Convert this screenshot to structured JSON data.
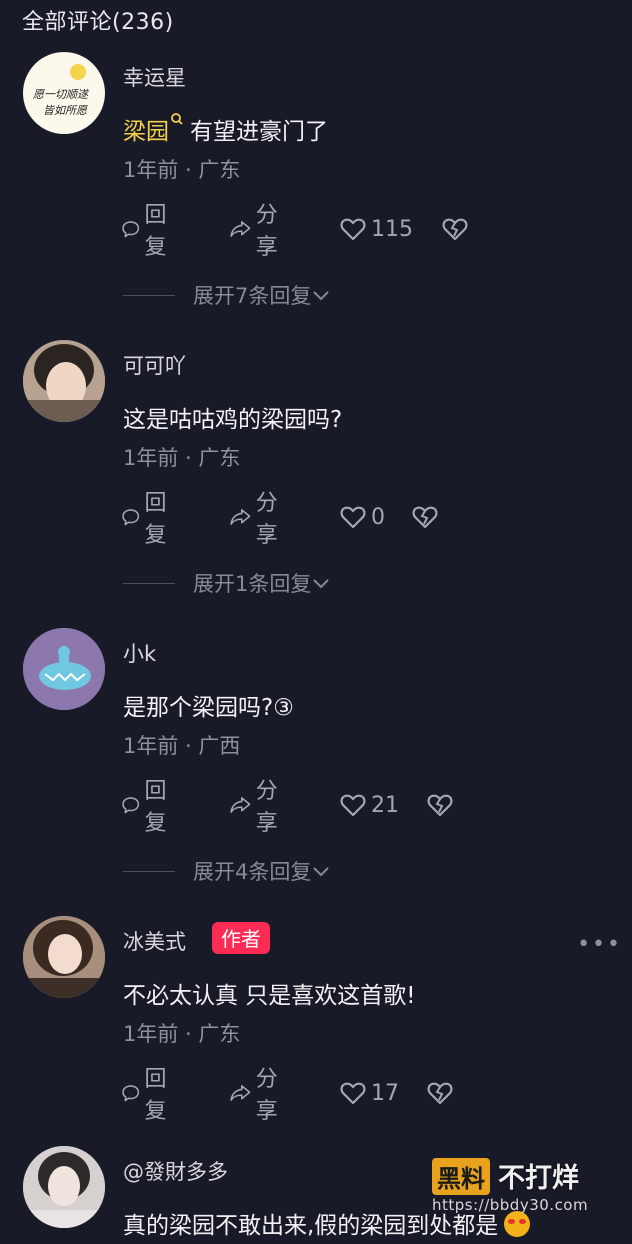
{
  "header": {
    "title": "全部评论(236)"
  },
  "comments": [
    {
      "username": "幸运星",
      "content_keyword": "梁园",
      "content_rest": "有望进豪门了",
      "meta": "1年前 · 广东",
      "reply_label": "回复",
      "share_label": "分享",
      "likes": "115",
      "expand": "展开7条回复",
      "avatar_text_1": "愿一切顺遂",
      "avatar_text_2": "皆如所愿"
    },
    {
      "username": "可可吖",
      "content": "这是咕咕鸡的梁园吗?",
      "meta": "1年前 · 广东",
      "reply_label": "回复",
      "share_label": "分享",
      "likes": "0",
      "expand": "展开1条回复"
    },
    {
      "username": "小k",
      "content": "是那个梁园吗?③",
      "meta": "1年前 · 广西",
      "reply_label": "回复",
      "share_label": "分享",
      "likes": "21",
      "expand": "展开4条回复"
    },
    {
      "username": "冰美式",
      "badge": "作者",
      "content": "不必太认真 只是喜欢这首歌!",
      "meta": "1年前 · 广东",
      "reply_label": "回复",
      "share_label": "分享",
      "likes": "17"
    },
    {
      "username": "@發財多多",
      "content": "真的梁园不敢出来,假的梁园到处都是"
    }
  ],
  "watermark": {
    "box": "黑料",
    "text": "不打烊",
    "url": "https://bbdy30.com"
  },
  "colors": {
    "background": "#181b27",
    "keyword": "#f6cf4a",
    "badge": "#fe2c55"
  }
}
